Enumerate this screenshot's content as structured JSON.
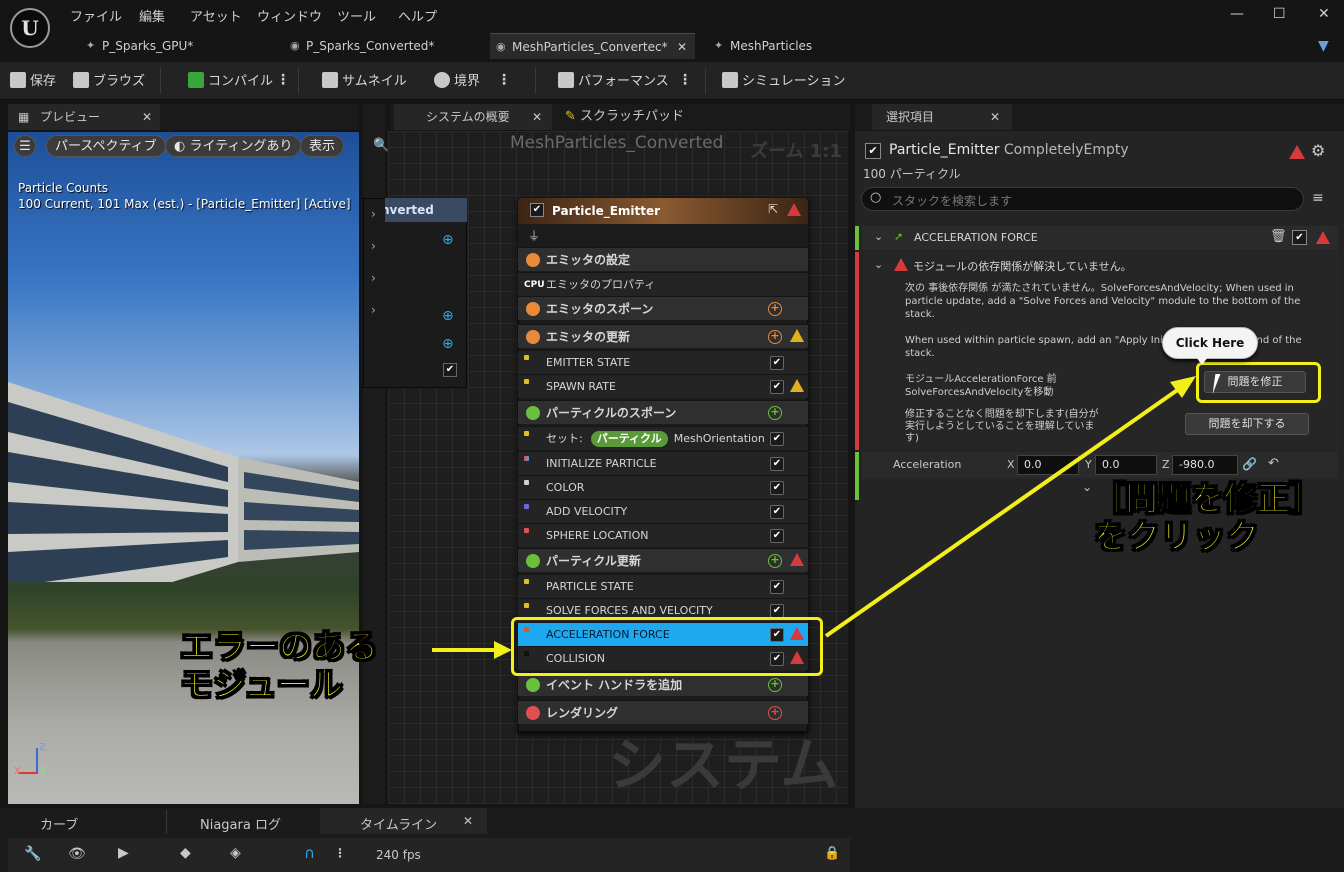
{
  "menu": {
    "items": [
      "ファイル",
      "編集",
      "アセット",
      "ウィンドウ",
      "ツール",
      "ヘルプ"
    ],
    "logo": "U"
  },
  "tabs": [
    {
      "label": "P_Sparks_GPU*"
    },
    {
      "label": "P_Sparks_Converted*"
    },
    {
      "label": "MeshParticles_Convertec*"
    },
    {
      "label": "MeshParticles"
    }
  ],
  "toolbar": {
    "save": "保存",
    "browse": "ブラウズ",
    "compile": "コンパイル",
    "thumbnail": "サムネイル",
    "bounds": "境界",
    "performance": "パフォーマンス",
    "simulation": "シミュレーション"
  },
  "preview": {
    "tab": "プレビュー",
    "perspective": "パースペクティブ",
    "lighting": "ライティングあり",
    "show": "表示",
    "stats_line1": "Particle Counts",
    "stats_line2": "100 Current, 101 Max (est.) - [Particle_Emitter] [Active]",
    "axis_z": "Z",
    "axis_x": "X",
    "axis_y": "Y"
  },
  "graph": {
    "tab_overview": "システムの概要",
    "tab_scratch": "スクラッチパッド",
    "title": "MeshParticles_Converted",
    "zoom": "ズーム 1:1",
    "partial_node": "nverted",
    "watermark": "システム"
  },
  "node": {
    "title": "Particle_Emitter",
    "rows": [
      {
        "label": "エミッタの設定",
        "group": true
      },
      {
        "label": "エミッタのプロパティ",
        "icon": "CPU"
      },
      {
        "label": "エミッタのスポーン",
        "group": true
      },
      {
        "label": "エミッタの更新",
        "group": true
      },
      {
        "label": "EMITTER STATE"
      },
      {
        "label": "SPAWN RATE"
      },
      {
        "label": "パーティクルのスポーン",
        "group": true
      },
      {
        "label": "セット:",
        "pill": "パーティクル",
        "tail": "MeshOrientation"
      },
      {
        "label": "INITIALIZE PARTICLE"
      },
      {
        "label": "COLOR"
      },
      {
        "label": "ADD VELOCITY"
      },
      {
        "label": "SPHERE LOCATION"
      },
      {
        "label": "パーティクル更新",
        "group": true
      },
      {
        "label": "PARTICLE STATE"
      },
      {
        "label": "SOLVE FORCES AND VELOCITY"
      },
      {
        "label": "ACCELERATION FORCE"
      },
      {
        "label": "COLLISION"
      },
      {
        "label": "イベント ハンドラを追加",
        "group": true
      },
      {
        "label": "レンダリング",
        "group": true
      }
    ]
  },
  "selection": {
    "tab": "選択項目",
    "emitter_name": "Particle_Emitter",
    "emitter_sub": "CompletelyEmpty",
    "particle_count": "100 パーティクル",
    "search_placeholder": "スタックを検索します",
    "module_title": "ACCELERATION FORCE",
    "issue_title": "モジュールの依存関係が解決していません。",
    "issue_text1": "次の 事後依存関係 が満たされていません。SolveForcesAndVelocity; When used in particle update, add a \"Solve Forces and Velocity\" module to the bottom of the stack.",
    "issue_text2": "When used within particle spawn, add an \"Apply Initi",
    "issue_text2_tail": "o the end of the stack.",
    "fix_desc": "モジュールAccelerationForce 前 SolveForcesAndVelocityを移動",
    "fix_button": "問題を修正",
    "dismiss_desc": "修正することなく問題を却下します(自分が実行しようとしていることを理解しています)",
    "dismiss_button": "問題を却下する",
    "accel_label": "Acceleration",
    "x_label": "X",
    "x_val": "0.0",
    "y_label": "Y",
    "y_val": "0.0",
    "z_label": "Z",
    "z_val": "-980.0",
    "tooltip": "Click Here"
  },
  "callouts": {
    "fix_line1": "［問題を修正］",
    "fix_line2": "をクリック",
    "err_line1": "エラーのある",
    "err_line2": "モジュール"
  },
  "bottom": {
    "tab_curve": "カーブ",
    "tab_log": "Niagara ログ",
    "tab_timeline": "タイムライン",
    "fps": "240 fps"
  }
}
